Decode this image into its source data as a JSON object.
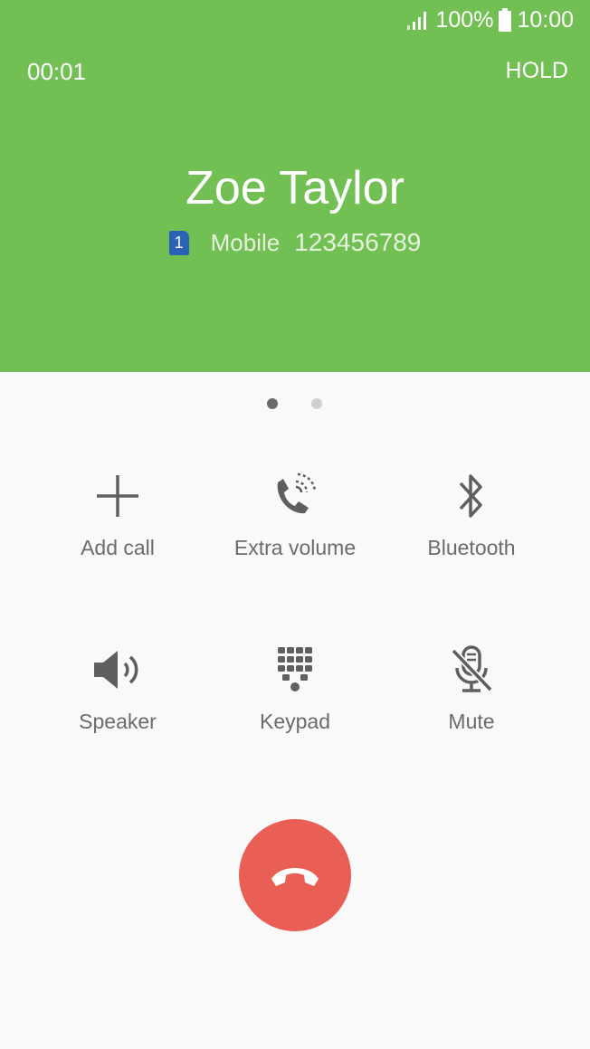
{
  "status_bar": {
    "battery": "100%",
    "time": "10:00"
  },
  "call": {
    "duration": "00:01",
    "hold_label": "HOLD",
    "caller_name": "Zoe Taylor",
    "sim_slot": "1",
    "number_type": "Mobile",
    "number": "123456789"
  },
  "pager": {
    "active_page": 1,
    "total_pages": 2
  },
  "actions": [
    {
      "label": "Add call",
      "icon": "plus-icon"
    },
    {
      "label": "Extra volume",
      "icon": "extra-volume-icon"
    },
    {
      "label": "Bluetooth",
      "icon": "bluetooth-icon"
    },
    {
      "label": "Speaker",
      "icon": "speaker-icon"
    },
    {
      "label": "Keypad",
      "icon": "keypad-icon"
    },
    {
      "label": "Mute",
      "icon": "mute-icon"
    }
  ],
  "end_call": {
    "icon": "end-call-icon"
  },
  "colors": {
    "header_background": "#72bf53",
    "end_call": "#ea5f55",
    "sim_badge": "#2a63b5",
    "action_icon": "#5f5f5f",
    "action_label": "#6b6b6b"
  }
}
